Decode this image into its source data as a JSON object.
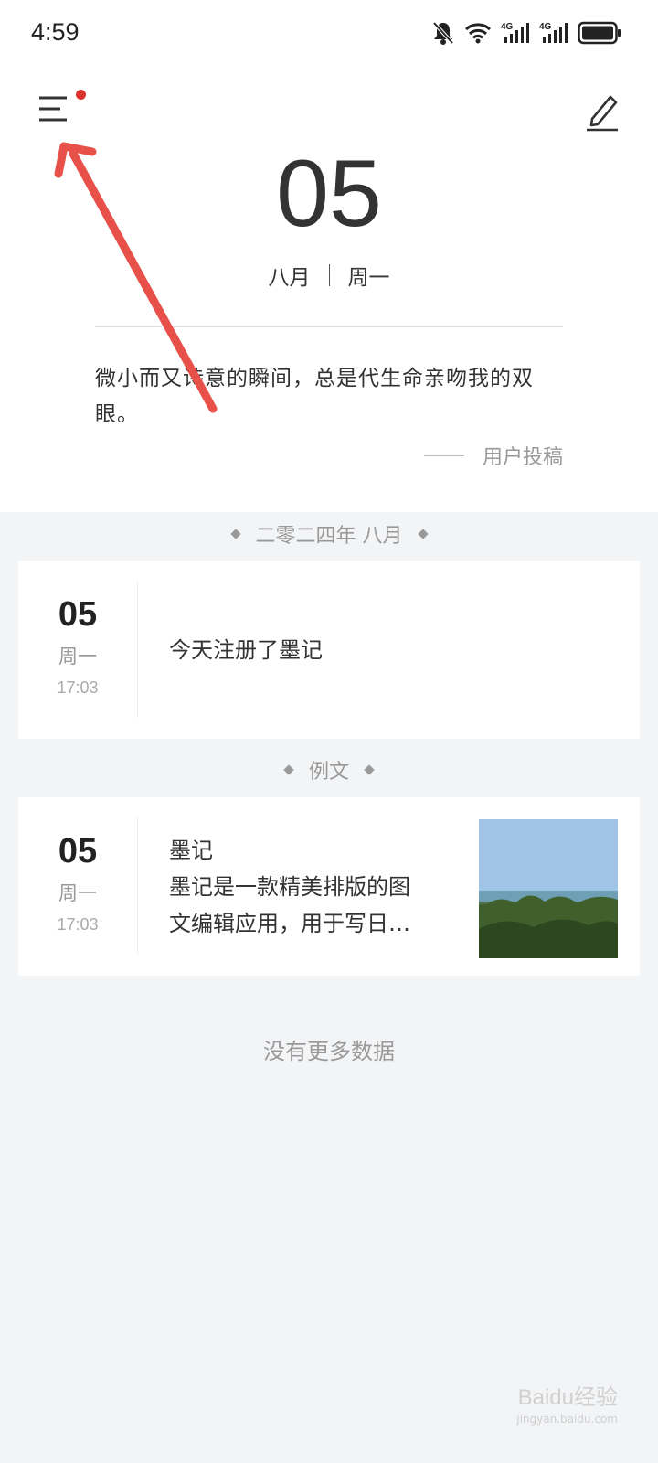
{
  "status_bar": {
    "time": "4:59",
    "icons": [
      "bell-off-icon",
      "wifi-icon",
      "4g-signal-icon",
      "4g-signal-icon",
      "battery-icon"
    ],
    "network_label": "4G"
  },
  "header": {
    "menu_icon": "menu-icon",
    "edit_icon": "edit-pencil-icon"
  },
  "today": {
    "day": "05",
    "month": "八月",
    "weekday": "周一"
  },
  "quote": {
    "text": "微小而又诗意的瞬间，总是代生命亲吻我的双眼。",
    "author": "用户投稿"
  },
  "sections": [
    {
      "header": "二零二四年 八月",
      "entry": {
        "day": "05",
        "weekday": "周一",
        "time": "17:03",
        "text": "今天注册了墨记"
      }
    },
    {
      "header": "例文",
      "entry": {
        "day": "05",
        "weekday": "周一",
        "time": "17:03",
        "title": "墨记",
        "excerpt_line1": "墨记是一款精美排版的图",
        "excerpt_line2": "文编辑应用，用于写日…"
      }
    }
  ],
  "footer": {
    "no_more": "没有更多数据"
  },
  "watermark": {
    "text": "Baidu经验",
    "sub": "jingyan.baidu.com"
  },
  "colors": {
    "accent_dot": "#d9342b",
    "annotation_arrow": "#e8504a",
    "page_bg": "#f3f4f6"
  }
}
